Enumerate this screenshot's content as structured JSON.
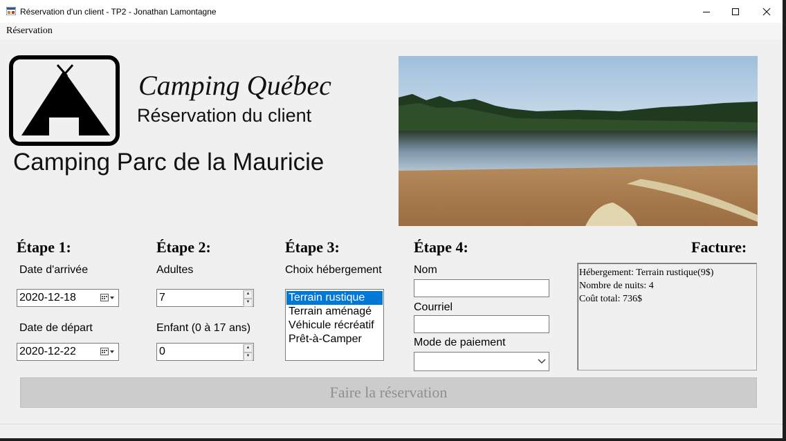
{
  "window": {
    "title": "Réservation d'un client - TP2 - Jonathan Lamontagne",
    "minimize_icon": "minimize-icon",
    "maximize_icon": "maximize-icon",
    "close_icon": "close-icon"
  },
  "menu": {
    "items": [
      "Réservation"
    ]
  },
  "header": {
    "brand": "Camping Québec",
    "subtitle": "Réservation du client",
    "park": "Camping Parc de la Mauricie",
    "logo_icon": "tent-icon"
  },
  "step1": {
    "title": "Étape 1:",
    "arrival_label": "Date d'arrivée",
    "arrival_value": "2020-12-18",
    "departure_label": "Date de départ",
    "departure_value": "2020-12-22"
  },
  "step2": {
    "title": "Étape 2:",
    "adults_label": "Adultes",
    "adults_value": "7",
    "children_label": "Enfant (0 à 17 ans)",
    "children_value": "0"
  },
  "step3": {
    "title": "Étape 3:",
    "label": "Choix hébergement",
    "options": [
      "Terrain rustique",
      "Terrain aménagé",
      "Véhicule récréatif",
      "Prêt-à-Camper"
    ],
    "selected_index": 0
  },
  "step4": {
    "title": "Étape 4:",
    "name_label": "Nom",
    "name_value": "",
    "email_label": "Courriel",
    "email_value": "",
    "payment_label": "Mode de paiement",
    "payment_value": ""
  },
  "invoice": {
    "title": "Facture:",
    "lines": [
      "Hébergement: Terrain rustique(9$)",
      "Nombre de nuits: 4",
      "Coût total: 736$"
    ]
  },
  "actions": {
    "submit_label": "Faire la réservation"
  },
  "colors": {
    "selection": "#0078d7",
    "window_bg": "#f0f0f0",
    "disabled_button": "#cccccc"
  }
}
